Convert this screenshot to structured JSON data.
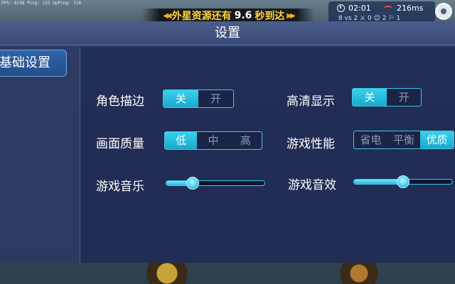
{
  "hud": {
    "debug_text": "FPS: 8/48  Ping: 125  UpPing: 118",
    "banner_prefix": "外星资源还有",
    "banner_value": "9.6",
    "banner_suffix": "秒到达",
    "time": "02:01",
    "ping": "216ms",
    "sub_row": "8   vs   2     ⚔ 0  ☺ 2  ⚐ 1"
  },
  "header": {
    "title": "设置"
  },
  "sidebar": {
    "tab_label": "基础设置"
  },
  "settings": {
    "outline": {
      "label": "角色描边",
      "options": [
        "关",
        "开"
      ],
      "selected": "关"
    },
    "hd_display": {
      "label": "高清显示",
      "options": [
        "关",
        "开"
      ],
      "selected": "关"
    },
    "quality": {
      "label": "画面质量",
      "options": [
        "低",
        "中",
        "高"
      ],
      "selected": "低"
    },
    "performance": {
      "label": "游戏性能",
      "options": [
        "省电",
        "平衡",
        "优质"
      ],
      "selected": "优质"
    },
    "music": {
      "label": "游戏音乐",
      "value": 0.27
    },
    "sfx": {
      "label": "游戏音效",
      "value": 0.5
    }
  },
  "colors": {
    "accent": "#38d2ee",
    "panel": "#2c3a64",
    "banner_text": "#ffd33a"
  }
}
